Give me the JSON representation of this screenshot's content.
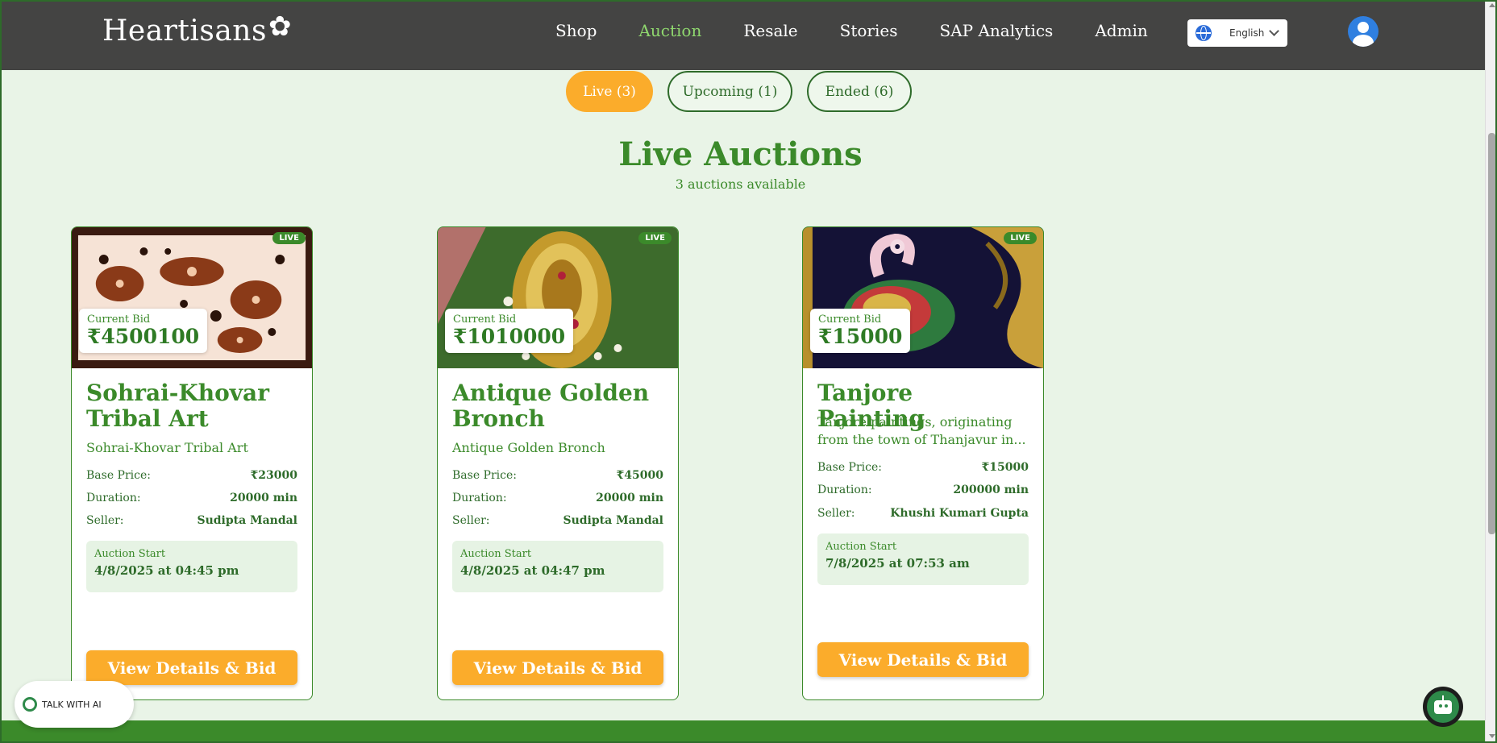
{
  "header": {
    "logo": "Heartisans",
    "nav": [
      "Shop",
      "Auction",
      "Resale",
      "Stories",
      "SAP Analytics",
      "Admin"
    ],
    "active_nav": "Auction",
    "language": "English"
  },
  "tabs": [
    {
      "label": "Live (3)",
      "active": true
    },
    {
      "label": "Upcoming (1)",
      "active": false
    },
    {
      "label": "Ended (6)",
      "active": false
    }
  ],
  "page": {
    "heading": "Live Auctions",
    "subheading": "3 auctions available"
  },
  "labels": {
    "live_badge": "LIVE",
    "current_bid": "Current Bid",
    "base_price": "Base Price:",
    "duration": "Duration:",
    "seller": "Seller:",
    "auction_start": "Auction Start",
    "button": "View Details & Bid"
  },
  "cards": [
    {
      "current_bid": "₹4500100",
      "title": "Sohrai-Khovar Tribal Art",
      "description": "Sohrai-Khovar Tribal Art",
      "base_price": "₹23000",
      "duration": "20000 min",
      "seller": "Sudipta Mandal",
      "start": "4/8/2025 at 04:45 pm",
      "image": "tribal-art-image"
    },
    {
      "current_bid": "₹1010000",
      "title": "Antique Golden Bronch",
      "description": "Antique Golden Bronch",
      "base_price": "₹45000",
      "duration": "20000 min",
      "seller": "Sudipta Mandal",
      "start": "4/8/2025 at 04:47 pm",
      "image": "golden-brooch-image"
    },
    {
      "current_bid": "₹15000",
      "title": "Tanjore Painting",
      "description": "Tanjore paintings, originating from the town of Thanjavur in...",
      "base_price": "₹15000",
      "duration": "200000 min",
      "seller": "Khushi Kumari Gupta",
      "start": "7/8/2025 at 07:53 am",
      "image": "tanjore-painting-image"
    }
  ],
  "widgets": {
    "talk_ai": "TALK WITH AI"
  },
  "colors": {
    "header_bg": "#444443",
    "accent_green": "#3b8a2a",
    "accent_orange": "#fbac2b",
    "page_bg": "#e9f4e7"
  }
}
